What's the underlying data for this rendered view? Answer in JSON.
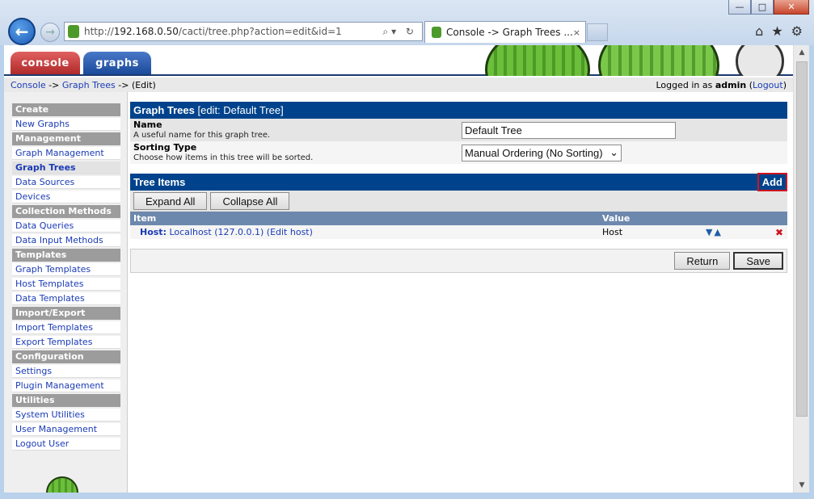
{
  "browser": {
    "url_prefix": "http://",
    "url_host": "192.168.0.50",
    "url_path": "/cacti/tree.php?action=edit&id=1",
    "tab_title": "Console -> Graph Trees ...",
    "tab_close": "×",
    "win_minimize": "—",
    "win_maximize": "□",
    "win_close": "✕",
    "address_tools": "⌕▾ ↻",
    "icons": [
      "home-icon",
      "star-icon",
      "gear-icon"
    ]
  },
  "cacti": {
    "tabs": {
      "console": "console",
      "graphs": "graphs"
    },
    "breadcrumb": {
      "console": "Console",
      "sep1": " -> ",
      "trees": "Graph Trees",
      "sep2": " -> ",
      "current": "(Edit)"
    },
    "login": {
      "prefix": "Logged in as ",
      "user": "admin",
      "open": " (",
      "logout": "Logout",
      "close": ")"
    }
  },
  "sidebar": {
    "sections": [
      {
        "title": "Create",
        "items": [
          "New Graphs"
        ]
      },
      {
        "title": "Management",
        "items": [
          "Graph Management",
          "Graph Trees",
          "Data Sources",
          "Devices"
        ]
      },
      {
        "title": "Collection Methods",
        "items": [
          "Data Queries",
          "Data Input Methods"
        ]
      },
      {
        "title": "Templates",
        "items": [
          "Graph Templates",
          "Host Templates",
          "Data Templates"
        ]
      },
      {
        "title": "Import/Export",
        "items": [
          "Import Templates",
          "Export Templates"
        ]
      },
      {
        "title": "Configuration",
        "items": [
          "Settings",
          "Plugin Management"
        ]
      },
      {
        "title": "Utilities",
        "items": [
          "System Utilities",
          "User Management",
          "Logout User"
        ]
      }
    ],
    "active_item": "Graph Trees"
  },
  "form": {
    "header_title": "Graph Trees",
    "header_sub": " [edit: Default Tree]",
    "name_label": "Name",
    "name_desc": "A useful name for this graph tree.",
    "name_value": "Default Tree",
    "sort_label": "Sorting Type",
    "sort_desc": "Choose how items in this tree will be sorted.",
    "sort_value": "Manual Ordering (No Sorting)"
  },
  "tree": {
    "header_title": "Tree Items",
    "add_label": "Add",
    "expand_label": "Expand All",
    "collapse_label": "Collapse All",
    "col_item": "Item",
    "col_value": "Value",
    "rows": [
      {
        "type_label": "Host:",
        "item": " Localhost (127.0.0.1) (Edit host)",
        "value": "Host"
      }
    ]
  },
  "footer": {
    "return_label": "Return",
    "save_label": "Save"
  }
}
